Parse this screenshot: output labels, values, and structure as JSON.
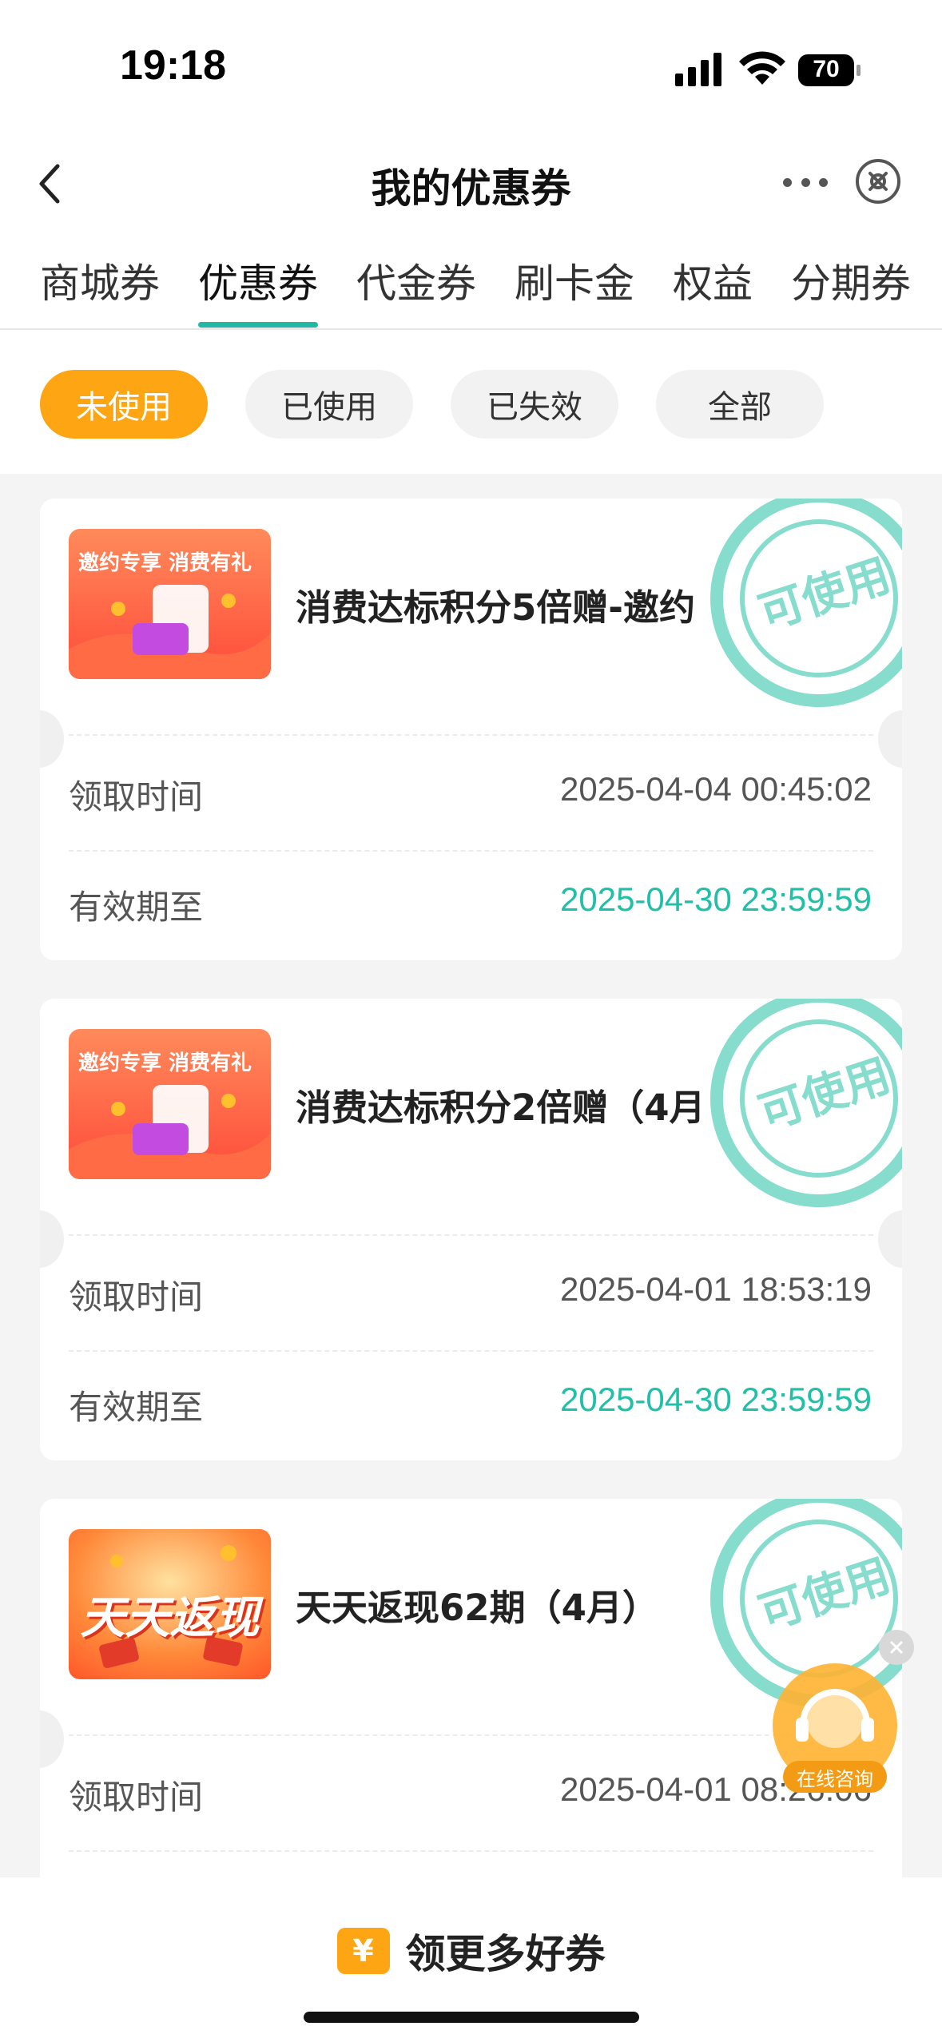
{
  "status": {
    "time": "19:18",
    "battery": "70"
  },
  "nav": {
    "title": "我的优惠券"
  },
  "tabs": [
    "商城券",
    "优惠券",
    "代金券",
    "刷卡金",
    "权益",
    "分期券"
  ],
  "filters": [
    "未使用",
    "已使用",
    "已失效",
    "全部"
  ],
  "stamp_text": "可使用",
  "labels": {
    "received": "领取时间",
    "valid_until": "有效期至"
  },
  "coupons": [
    {
      "title": "消费达标积分5倍赠-邀约",
      "thumb_text": "邀约专享 消费有礼",
      "received": "2025-04-04 00:45:02",
      "valid_until": "2025-04-30 23:59:59"
    },
    {
      "title": "消费达标积分2倍赠（4月",
      "thumb_text": "邀约专享 消费有礼",
      "received": "2025-04-01 18:53:19",
      "valid_until": "2025-04-30 23:59:59"
    },
    {
      "title": "天天返现62期（4月）",
      "thumb_text": "天天返现",
      "received": "2025-04-01 08:26:06",
      "valid_until": ""
    }
  ],
  "consult_label": "在线咨询",
  "bottom": {
    "label": "领更多好券",
    "icon_text": "¥"
  },
  "colors": {
    "accent": "#fda513",
    "teal": "#1fbfa8",
    "stamp": "#86dccd"
  }
}
